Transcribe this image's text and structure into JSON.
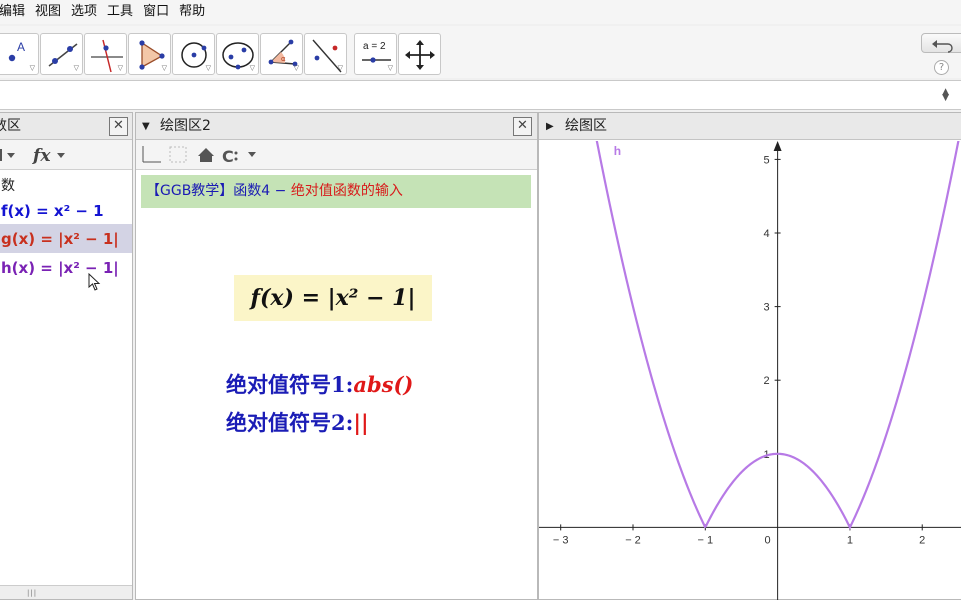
{
  "menubar": {
    "items": [
      "编辑",
      "视图",
      "选项",
      "工具",
      "窗口",
      "帮助"
    ]
  },
  "toolbar": {
    "tools": [
      "point-tool-icon",
      "line-tool-icon",
      "perpendicular-tool-icon",
      "polygon-tool-icon",
      "circle-tool-icon",
      "conic-tool-icon",
      "angle-tool-icon",
      "reflect-tool-icon",
      "slider-tool-icon",
      "move-graphics-tool-icon"
    ],
    "slider_label": "a = 2",
    "help_label": "?"
  },
  "algebra": {
    "title": "数区",
    "category": "数",
    "rows": [
      {
        "text": "f(x) = x² − 1",
        "color": "#1414d2"
      },
      {
        "text": "g(x) = |x² − 1|",
        "color": "#c8301e"
      },
      {
        "text": "h(x) = |x² − 1|",
        "color": "#7a22b4"
      }
    ]
  },
  "graphics2": {
    "title": "绘图区2",
    "banner_left": "【GGB教学】函数4 − ",
    "banner_right": "绝对值函数的输入",
    "formula": "f(x) = |x² − 1|",
    "abs_line1_label": "绝对值符号1:",
    "abs_line1_value": "abs()",
    "abs_line2_label": "绝对值符号2:",
    "abs_line2_value": "||"
  },
  "graphics1": {
    "title": "绘图区"
  },
  "chart_data": {
    "type": "line",
    "function": "h(x) = |x² − 1|",
    "series": [
      {
        "name": "h",
        "color": "#b77ae6",
        "x": [
          -2.45,
          -2,
          -1.5,
          -1,
          -0.5,
          0,
          0.5,
          1,
          1.5,
          2,
          2.45
        ],
        "y": [
          5.0,
          3,
          1.25,
          0,
          0.75,
          1,
          0.75,
          0,
          1.25,
          3,
          5.0
        ]
      }
    ],
    "xlim": [
      -3.3,
      2.55
    ],
    "ylim": [
      -1.0,
      5.25
    ],
    "x_ticks": [
      "-3",
      "-2",
      "-1",
      "0",
      "1",
      "2"
    ],
    "y_ticks": [
      "1",
      "2",
      "3",
      "4",
      "5"
    ],
    "grid": false
  }
}
